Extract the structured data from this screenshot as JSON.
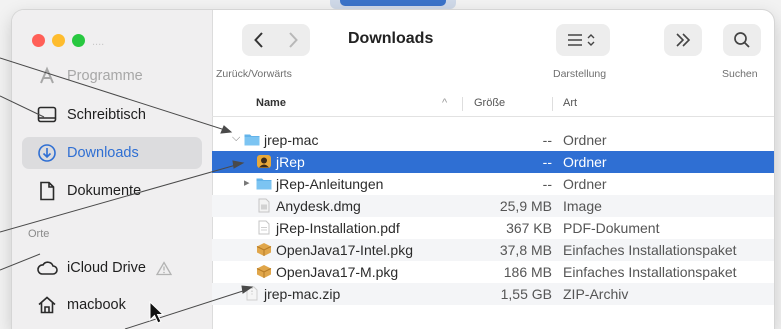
{
  "window": {
    "title": "Downloads",
    "accent": "#2f6fd3"
  },
  "sidebar": {
    "ghost_label": "....",
    "items": [
      {
        "label": "Programme",
        "icon": "applications-icon",
        "faded": true
      },
      {
        "label": "Schreibtisch",
        "icon": "desktop-icon"
      },
      {
        "label": "Downloads",
        "icon": "download-circle-icon",
        "selected": true
      },
      {
        "label": "Dokumente",
        "icon": "document-icon"
      }
    ],
    "section_label": "Orte",
    "places": [
      {
        "label": "iCloud Drive",
        "icon": "cloud-icon"
      },
      {
        "label": "macbook",
        "icon": "home-icon"
      }
    ]
  },
  "toolbar": {
    "back_glyph": "‹",
    "forward_glyph": "›",
    "nav_label": "Zurück/Vorwärts",
    "view_label": "Darstellung",
    "search_label": "Suchen"
  },
  "columns": {
    "name": "Name",
    "size": "Größe",
    "kind": "Art",
    "sort_glyph": "^"
  },
  "files": [
    {
      "name": "jrep-mac",
      "size": "--",
      "kind": "Ordner",
      "icon": "folder-icon",
      "indent": 0,
      "disclosure": "v"
    },
    {
      "name": "jRep",
      "size": "--",
      "kind": "Ordner",
      "icon": "app-icon",
      "indent": 1,
      "selected": true
    },
    {
      "name": "jRep-Anleitungen",
      "size": "--",
      "kind": "Ordner",
      "icon": "folder-icon",
      "indent": 1,
      "disclosure": ">"
    },
    {
      "name": "Anydesk.dmg",
      "size": "25,9 MB",
      "kind": "Image",
      "icon": "disk-image-icon",
      "indent": 1
    },
    {
      "name": "jRep-Installation.pdf",
      "size": "367 KB",
      "kind": "PDF-Dokument",
      "icon": "pdf-icon",
      "indent": 1
    },
    {
      "name": "OpenJava17-Intel.pkg",
      "size": "37,8 MB",
      "kind": "Einfaches Installationspaket",
      "icon": "package-icon",
      "indent": 1
    },
    {
      "name": "OpenJava17-M.pkg",
      "size": "186 MB",
      "kind": "Einfaches Installationspaket",
      "icon": "package-icon",
      "indent": 1
    },
    {
      "name": "jrep-mac.zip",
      "size": "1,55 GB",
      "kind": "ZIP-Archiv",
      "icon": "zip-icon",
      "indent": 0
    }
  ]
}
